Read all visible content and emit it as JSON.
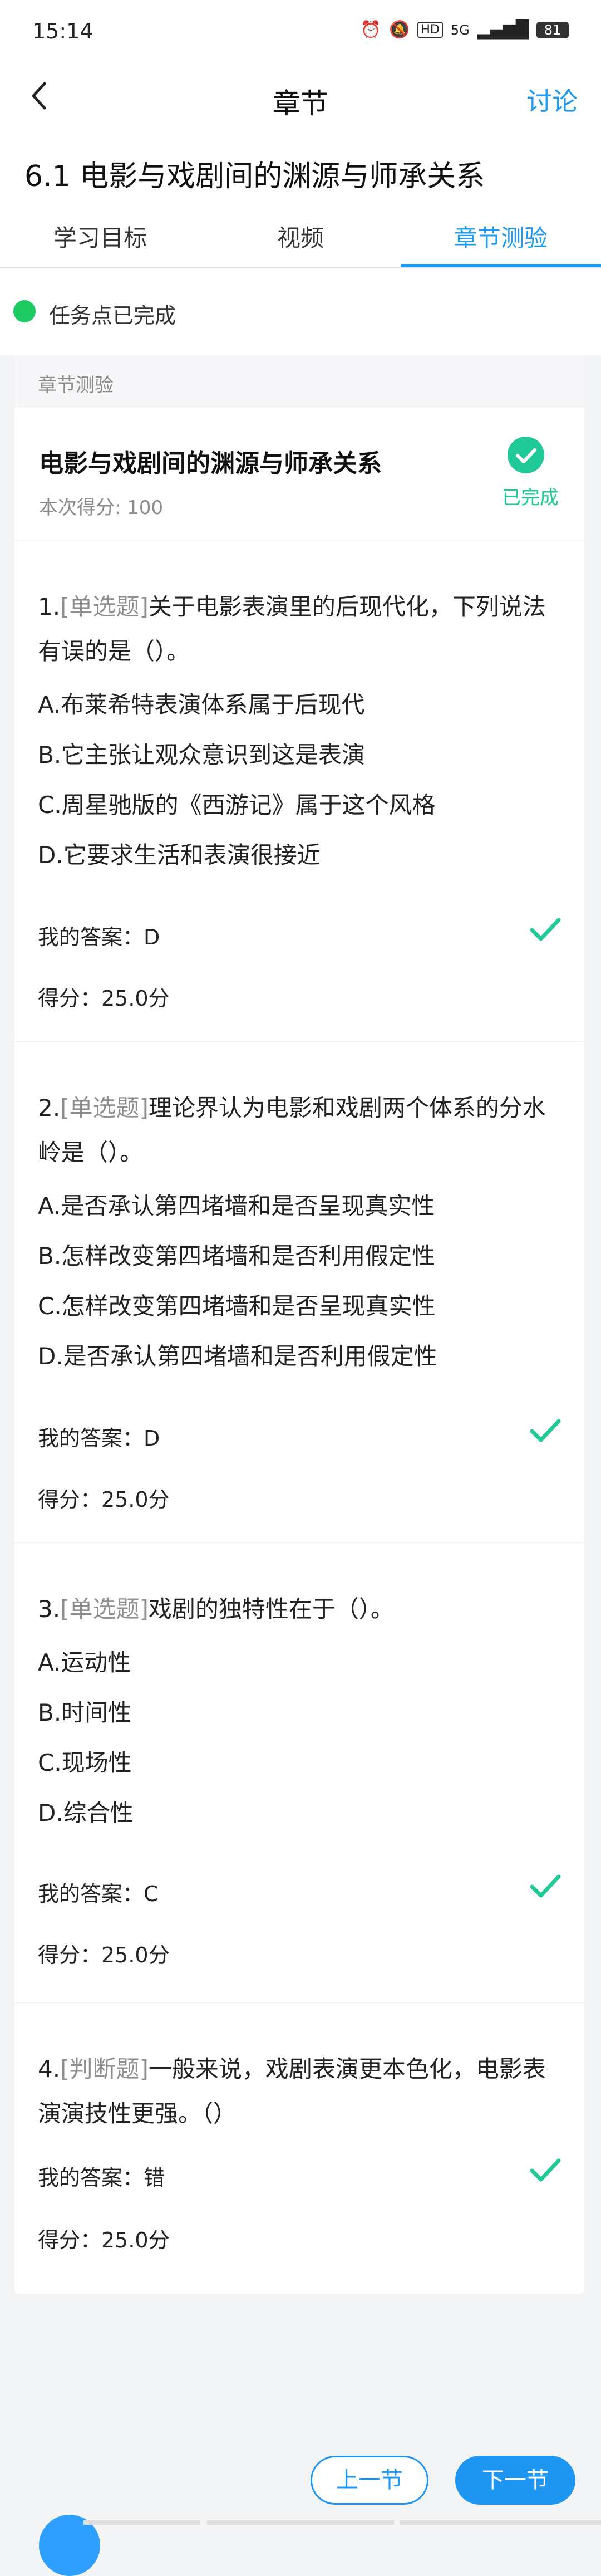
{
  "status_bar": {
    "time": "15:14",
    "icons": [
      "alarm-icon",
      "mute-icon",
      "hd-icon",
      "signal-icon"
    ],
    "network": "5G",
    "battery": "81"
  },
  "nav": {
    "title": "章节",
    "action": "讨论"
  },
  "chapter": {
    "title": "6.1 电影与戏剧间的渊源与师承关系"
  },
  "tabs": [
    {
      "label": "学习目标",
      "active": false
    },
    {
      "label": "视频",
      "active": false
    },
    {
      "label": "章节测验",
      "active": true
    }
  ],
  "task_status": {
    "text": "任务点已完成",
    "color": "#1ecb63"
  },
  "quiz": {
    "section_label": "章节测验",
    "title": "电影与戏剧间的渊源与师承关系",
    "score_text": "本次得分: 100",
    "completed_label": "已完成",
    "accent_color": "#20c997",
    "questions": [
      {
        "number": "1.",
        "type": "[单选题]",
        "stem": "关于电影表演里的后现代化，下列说法有误的是（）。",
        "options": [
          "A.布莱希特表演体系属于后现代",
          "B.它主张让观众意识到这是表演",
          "C.周星驰版的《西游记》属于这个风格",
          "D.它要求生活和表演很接近"
        ],
        "answer": "我的答案：D",
        "score": "得分：25.0分"
      },
      {
        "number": "2.",
        "type": "[单选题]",
        "stem": "理论界认为电影和戏剧两个体系的分水岭是（）。",
        "options": [
          "A.是否承认第四堵墙和是否呈现真实性",
          "B.怎样改变第四堵墙和是否利用假定性",
          "C.怎样改变第四堵墙和是否呈现真实性",
          "D.是否承认第四堵墙和是否利用假定性"
        ],
        "answer": "我的答案：D",
        "score": "得分：25.0分"
      },
      {
        "number": "3.",
        "type": "[单选题]",
        "stem": "戏剧的独特性在于（）。",
        "options": [
          "A.运动性",
          "B.时间性",
          "C.现场性",
          "D.综合性"
        ],
        "answer": "我的答案：C",
        "score": "得分：25.0分"
      },
      {
        "number": "4.",
        "type": "[判断题]",
        "stem": "一般来说，戏剧表演更本色化，电影表演演技性更强。（）",
        "options": [],
        "answer": "我的答案：错",
        "score": "得分：25.0分"
      }
    ]
  },
  "footer": {
    "prev_label": "上一节",
    "next_label": "下一节"
  }
}
